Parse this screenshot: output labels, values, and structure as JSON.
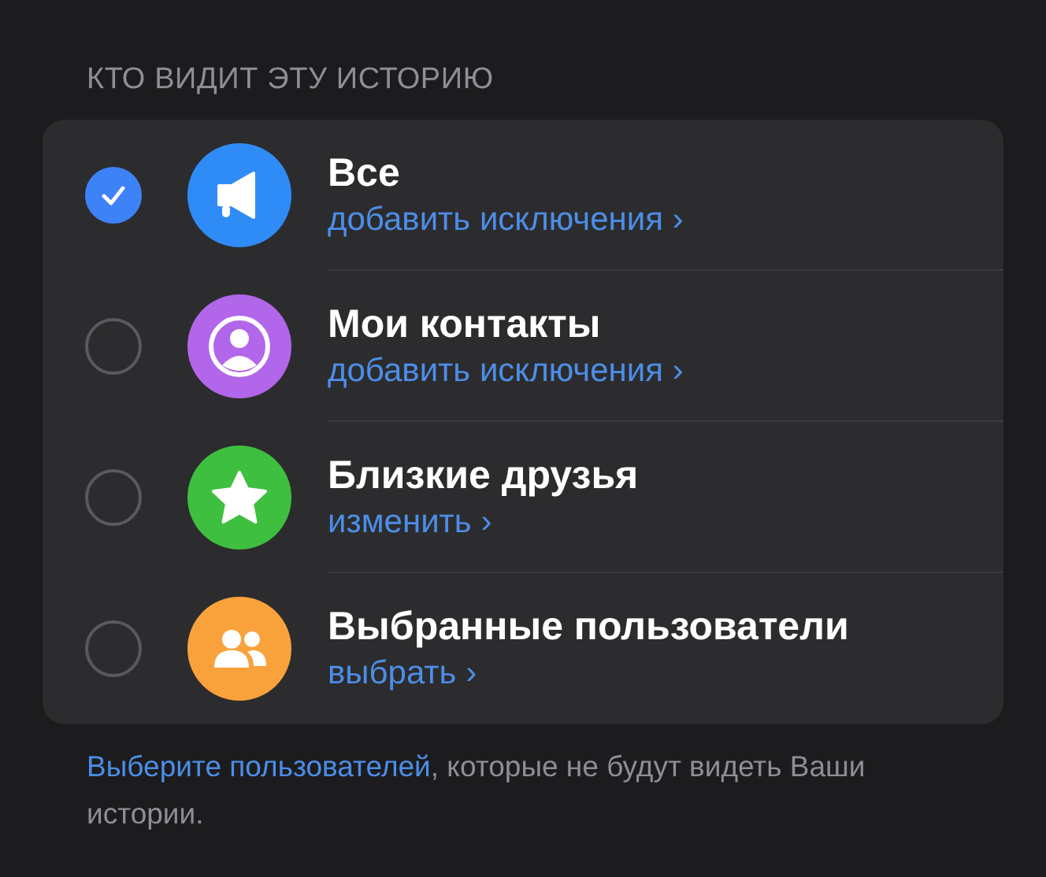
{
  "section_title": "КТО ВИДИТ ЭТУ ИСТОРИЮ",
  "options": [
    {
      "title": "Все",
      "action": "добавить исключения",
      "chevron": "›",
      "selected": true,
      "color": "#2f8cf6"
    },
    {
      "title": "Мои контакты",
      "action": "добавить исключения",
      "chevron": "›",
      "selected": false,
      "color": "#b266ea"
    },
    {
      "title": "Близкие друзья",
      "action": "изменить",
      "chevron": "›",
      "selected": false,
      "color": "#3fbf3f"
    },
    {
      "title": "Выбранные пользователи",
      "action": "выбрать",
      "chevron": "›",
      "selected": false,
      "color": "#f9a23c"
    }
  ],
  "footer": {
    "link": "Выберите пользователей",
    "text": ", которые не будут видеть Ваши истории."
  }
}
